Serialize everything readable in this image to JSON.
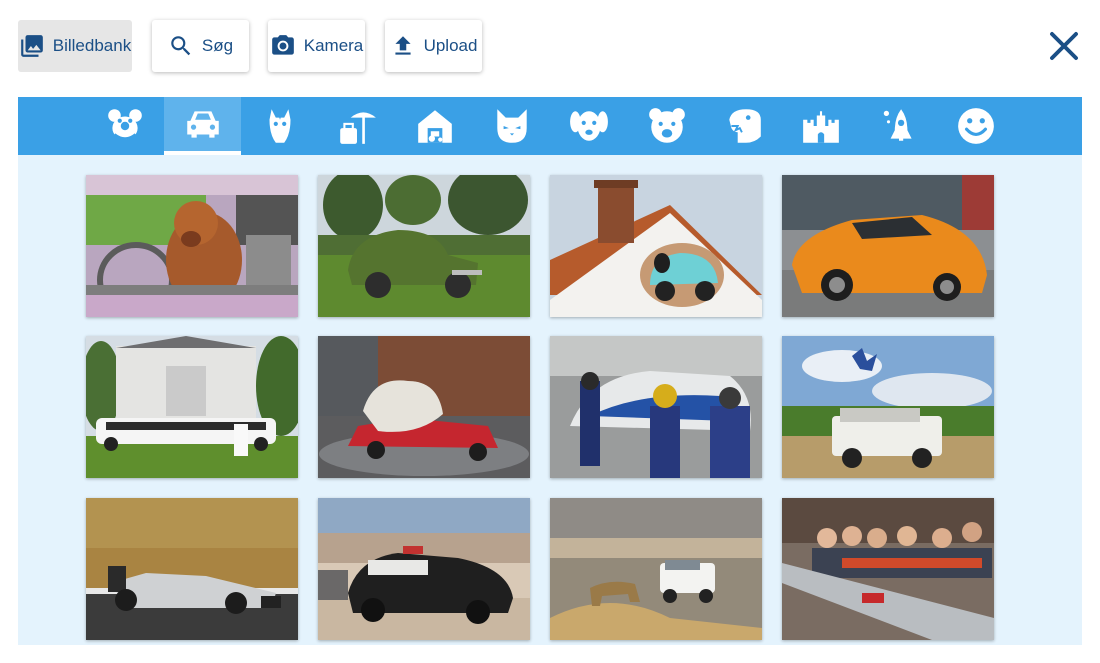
{
  "toolbar": {
    "buttons": [
      {
        "label": "Billedbank",
        "icon": "image-library-icon",
        "active": true
      },
      {
        "label": "Søg",
        "icon": "search-icon"
      },
      {
        "label": "Kamera",
        "icon": "camera-icon"
      },
      {
        "label": "Upload",
        "icon": "upload-icon"
      }
    ],
    "close_icon": "close-icon"
  },
  "categories": {
    "active_index": 1,
    "items": [
      {
        "icon": "clown-face-icon"
      },
      {
        "icon": "car-icon"
      },
      {
        "icon": "horse-icon"
      },
      {
        "icon": "beach-icon"
      },
      {
        "icon": "farm-barn-icon"
      },
      {
        "icon": "cat-icon"
      },
      {
        "icon": "dog-icon"
      },
      {
        "icon": "bear-icon"
      },
      {
        "icon": "dinosaur-icon"
      },
      {
        "icon": "castle-icon"
      },
      {
        "icon": "rocket-icon"
      },
      {
        "icon": "smiley-icon"
      }
    ]
  },
  "images": [
    {
      "name": "dog-driving-car"
    },
    {
      "name": "hedge-car-sculpture"
    },
    {
      "name": "car-through-house-wall"
    },
    {
      "name": "orange-sports-car"
    },
    {
      "name": "white-limousine-wedding"
    },
    {
      "name": "rock-crushing-car"
    },
    {
      "name": "racing-pit-stop"
    },
    {
      "name": "offroad-jeep-jump"
    },
    {
      "name": "formula-one-car"
    },
    {
      "name": "wrecked-police-car"
    },
    {
      "name": "lion-by-car"
    },
    {
      "name": "kids-toy-car-race"
    }
  ],
  "colors": {
    "accent": "#3aa0e6",
    "accent_dark": "#1b4f86",
    "panel_bg": "#e4f3fd"
  }
}
